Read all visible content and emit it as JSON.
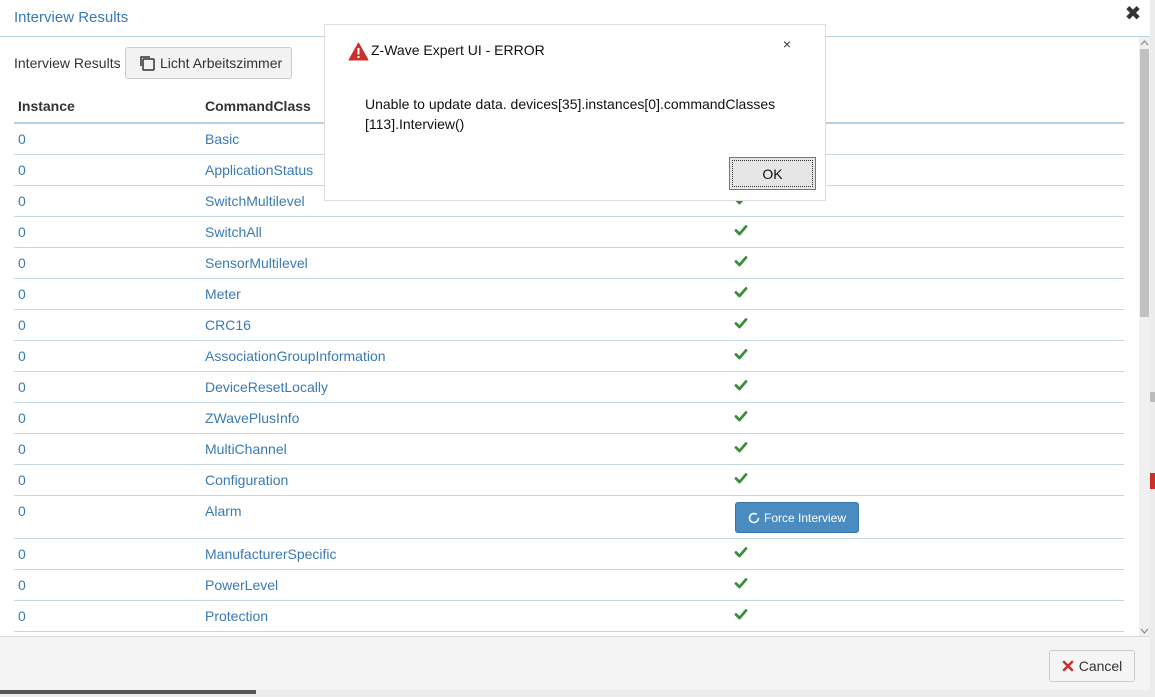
{
  "modal": {
    "title": "Interview Results",
    "toolbar_label": "Interview Results",
    "device_button": "Licht Arbeitszimmer",
    "cancel_label": "Cancel"
  },
  "table": {
    "headers": {
      "instance": "Instance",
      "command_class": "CommandClass"
    },
    "rows": [
      {
        "instance": "0",
        "command_class": "Basic",
        "status": "ok"
      },
      {
        "instance": "0",
        "command_class": "ApplicationStatus",
        "status": "ok"
      },
      {
        "instance": "0",
        "command_class": "SwitchMultilevel",
        "status": "ok"
      },
      {
        "instance": "0",
        "command_class": "SwitchAll",
        "status": "ok"
      },
      {
        "instance": "0",
        "command_class": "SensorMultilevel",
        "status": "ok"
      },
      {
        "instance": "0",
        "command_class": "Meter",
        "status": "ok"
      },
      {
        "instance": "0",
        "command_class": "CRC16",
        "status": "ok"
      },
      {
        "instance": "0",
        "command_class": "AssociationGroupInformation",
        "status": "ok"
      },
      {
        "instance": "0",
        "command_class": "DeviceResetLocally",
        "status": "ok"
      },
      {
        "instance": "0",
        "command_class": "ZWavePlusInfo",
        "status": "ok"
      },
      {
        "instance": "0",
        "command_class": "MultiChannel",
        "status": "ok"
      },
      {
        "instance": "0",
        "command_class": "Configuration",
        "status": "ok"
      },
      {
        "instance": "0",
        "command_class": "Alarm",
        "status": "force",
        "button_label": "Force Interview"
      },
      {
        "instance": "0",
        "command_class": "ManufacturerSpecific",
        "status": "ok"
      },
      {
        "instance": "0",
        "command_class": "PowerLevel",
        "status": "ok"
      },
      {
        "instance": "0",
        "command_class": "Protection",
        "status": "ok"
      }
    ]
  },
  "dialog": {
    "title": "Z-Wave Expert UI - ERROR",
    "message": "Unable to update data. devices[35].instances[0].commandClasses [113].Interview()",
    "ok_label": "OK",
    "close_glyph": "×"
  },
  "colors": {
    "link": "#3a7ab3",
    "check": "#3c8c3c",
    "primary_button": "#4a8cc0",
    "warning": "#c9302c"
  }
}
